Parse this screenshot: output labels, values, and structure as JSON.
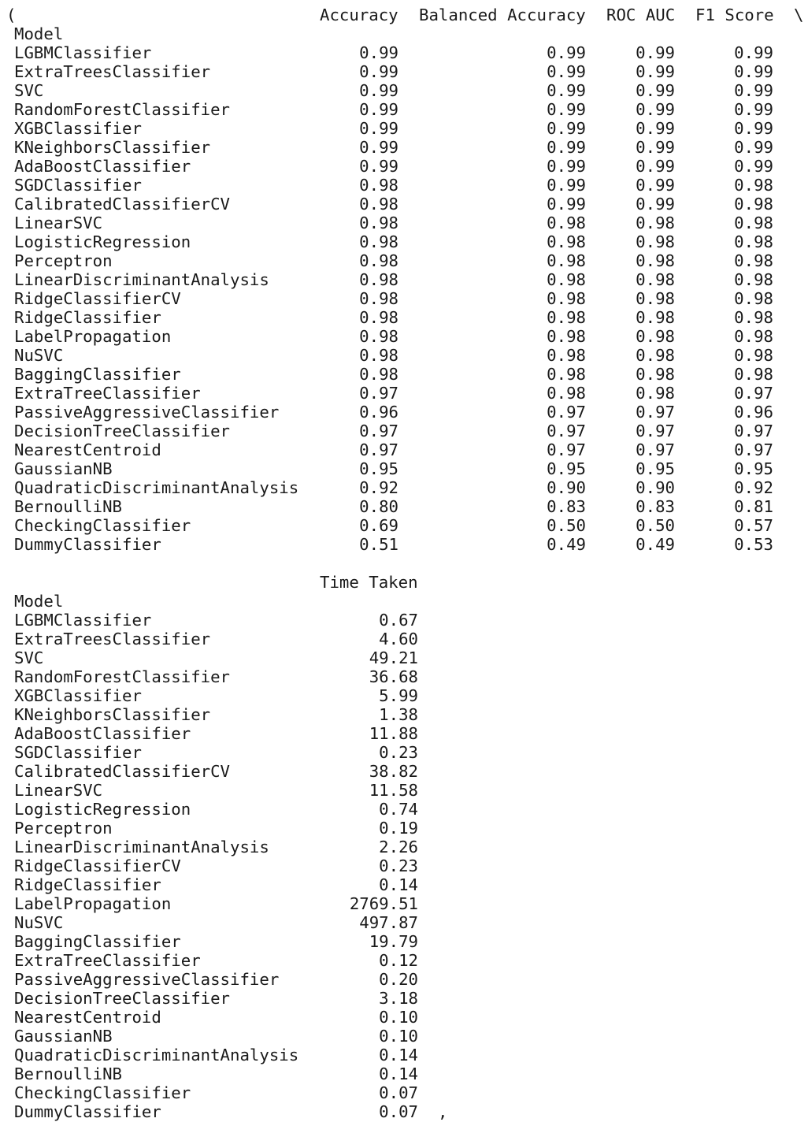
{
  "output": {
    "open_paren": "(",
    "continuation": "\\",
    "close_paren_comma": ",",
    "index_name": "Model",
    "table1": {
      "columns": [
        "Accuracy",
        "Balanced Accuracy",
        "ROC AUC",
        "F1 Score"
      ],
      "rows": [
        [
          "LGBMClassifier",
          "0.99",
          "0.99",
          "0.99",
          "0.99"
        ],
        [
          "ExtraTreesClassifier",
          "0.99",
          "0.99",
          "0.99",
          "0.99"
        ],
        [
          "SVC",
          "0.99",
          "0.99",
          "0.99",
          "0.99"
        ],
        [
          "RandomForestClassifier",
          "0.99",
          "0.99",
          "0.99",
          "0.99"
        ],
        [
          "XGBClassifier",
          "0.99",
          "0.99",
          "0.99",
          "0.99"
        ],
        [
          "KNeighborsClassifier",
          "0.99",
          "0.99",
          "0.99",
          "0.99"
        ],
        [
          "AdaBoostClassifier",
          "0.99",
          "0.99",
          "0.99",
          "0.99"
        ],
        [
          "SGDClassifier",
          "0.98",
          "0.99",
          "0.99",
          "0.98"
        ],
        [
          "CalibratedClassifierCV",
          "0.98",
          "0.99",
          "0.99",
          "0.98"
        ],
        [
          "LinearSVC",
          "0.98",
          "0.98",
          "0.98",
          "0.98"
        ],
        [
          "LogisticRegression",
          "0.98",
          "0.98",
          "0.98",
          "0.98"
        ],
        [
          "Perceptron",
          "0.98",
          "0.98",
          "0.98",
          "0.98"
        ],
        [
          "LinearDiscriminantAnalysis",
          "0.98",
          "0.98",
          "0.98",
          "0.98"
        ],
        [
          "RidgeClassifierCV",
          "0.98",
          "0.98",
          "0.98",
          "0.98"
        ],
        [
          "RidgeClassifier",
          "0.98",
          "0.98",
          "0.98",
          "0.98"
        ],
        [
          "LabelPropagation",
          "0.98",
          "0.98",
          "0.98",
          "0.98"
        ],
        [
          "NuSVC",
          "0.98",
          "0.98",
          "0.98",
          "0.98"
        ],
        [
          "BaggingClassifier",
          "0.98",
          "0.98",
          "0.98",
          "0.98"
        ],
        [
          "ExtraTreeClassifier",
          "0.97",
          "0.98",
          "0.98",
          "0.97"
        ],
        [
          "PassiveAggressiveClassifier",
          "0.96",
          "0.97",
          "0.97",
          "0.96"
        ],
        [
          "DecisionTreeClassifier",
          "0.97",
          "0.97",
          "0.97",
          "0.97"
        ],
        [
          "NearestCentroid",
          "0.97",
          "0.97",
          "0.97",
          "0.97"
        ],
        [
          "GaussianNB",
          "0.95",
          "0.95",
          "0.95",
          "0.95"
        ],
        [
          "QuadraticDiscriminantAnalysis",
          "0.92",
          "0.90",
          "0.90",
          "0.92"
        ],
        [
          "BernoulliNB",
          "0.80",
          "0.83",
          "0.83",
          "0.81"
        ],
        [
          "CheckingClassifier",
          "0.69",
          "0.50",
          "0.50",
          "0.57"
        ],
        [
          "DummyClassifier",
          "0.51",
          "0.49",
          "0.49",
          "0.53"
        ]
      ]
    },
    "table2": {
      "columns": [
        "Time Taken"
      ],
      "rows": [
        [
          "LGBMClassifier",
          "0.67"
        ],
        [
          "ExtraTreesClassifier",
          "4.60"
        ],
        [
          "SVC",
          "49.21"
        ],
        [
          "RandomForestClassifier",
          "36.68"
        ],
        [
          "XGBClassifier",
          "5.99"
        ],
        [
          "KNeighborsClassifier",
          "1.38"
        ],
        [
          "AdaBoostClassifier",
          "11.88"
        ],
        [
          "SGDClassifier",
          "0.23"
        ],
        [
          "CalibratedClassifierCV",
          "38.82"
        ],
        [
          "LinearSVC",
          "11.58"
        ],
        [
          "LogisticRegression",
          "0.74"
        ],
        [
          "Perceptron",
          "0.19"
        ],
        [
          "LinearDiscriminantAnalysis",
          "2.26"
        ],
        [
          "RidgeClassifierCV",
          "0.23"
        ],
        [
          "RidgeClassifier",
          "0.14"
        ],
        [
          "LabelPropagation",
          "2769.51"
        ],
        [
          "NuSVC",
          "497.87"
        ],
        [
          "BaggingClassifier",
          "19.79"
        ],
        [
          "ExtraTreeClassifier",
          "0.12"
        ],
        [
          "PassiveAggressiveClassifier",
          "0.20"
        ],
        [
          "DecisionTreeClassifier",
          "3.18"
        ],
        [
          "NearestCentroid",
          "0.10"
        ],
        [
          "GaussianNB",
          "0.10"
        ],
        [
          "QuadraticDiscriminantAnalysis",
          "0.14"
        ],
        [
          "BernoulliNB",
          "0.14"
        ],
        [
          "CheckingClassifier",
          "0.07"
        ],
        [
          "DummyClassifier",
          "0.07"
        ]
      ]
    }
  }
}
